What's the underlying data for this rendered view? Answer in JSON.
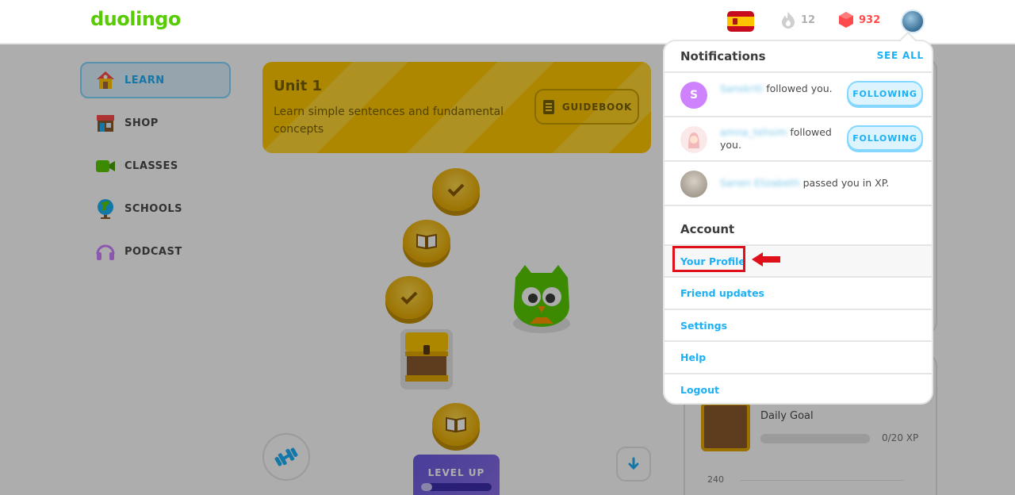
{
  "header": {
    "logo": "duolingo",
    "streak_count": "12",
    "gems_count": "932",
    "flag": "spain-flag-icon"
  },
  "sidebar": {
    "items": [
      {
        "label": "LEARN",
        "icon": "house-icon",
        "active": true
      },
      {
        "label": "SHOP",
        "icon": "shop-icon"
      },
      {
        "label": "CLASSES",
        "icon": "video-camera-icon"
      },
      {
        "label": "SCHOOLS",
        "icon": "globe-icon"
      },
      {
        "label": "PODCAST",
        "icon": "headphones-icon"
      }
    ]
  },
  "unit": {
    "title": "Unit 1",
    "description": "Learn simple sentences and fundamental concepts",
    "guidebook_label": "GUIDEBOOK"
  },
  "path": {
    "level_up_label": "LEVEL UP",
    "level_up_progress": 0.1
  },
  "daily_goal": {
    "label": "Daily Goal",
    "xp": "0/20 XP",
    "axis_value": "240"
  },
  "dropdown": {
    "notifications_title": "Notifications",
    "see_all": "SEE ALL",
    "notifications": [
      {
        "avatar_letter": "S",
        "name": "Sanskriti",
        "action": "followed you.",
        "button": "FOLLOWING",
        "avatar_color": "#ce82ff"
      },
      {
        "avatar_letter": "",
        "name": "amna_tehsim",
        "action": "followed you.",
        "button": "FOLLOWING",
        "avatar_color": "#f5d6d6"
      },
      {
        "avatar_letter": "",
        "name": "Sanen Elizabeth",
        "action": "passed you in XP.",
        "button": "",
        "avatar_color": "#b0a89a"
      }
    ],
    "account_title": "Account",
    "account_items": [
      "Your Profile",
      "Friend updates",
      "Settings",
      "Help",
      "Logout"
    ]
  },
  "colors": {
    "brand_green": "#58cc02",
    "accent_blue": "#1cb0f6",
    "gem_red": "#ff4b4b",
    "annotation_red": "#e0101b"
  }
}
